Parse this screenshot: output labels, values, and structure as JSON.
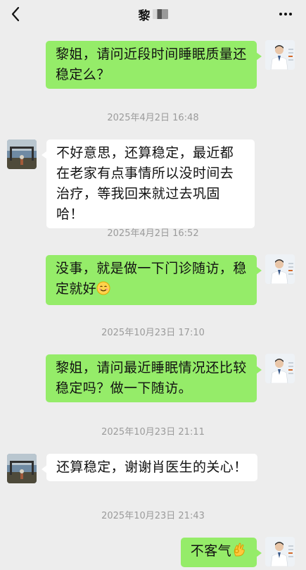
{
  "header": {
    "title": "黎",
    "back_icon": "chevron-left-icon",
    "more_icon": "more-dots-icon"
  },
  "messages": [
    {
      "side": "out",
      "text": "黎姐，请问近段时间睡眠质量还稳定么？"
    },
    {
      "time": "2025年4月2日 16:48"
    },
    {
      "side": "in",
      "text": "不好意思，还算稳定，最近都在老家有点事情所以没时间去治疗，等我回来就过去巩固哈！"
    },
    {
      "time": "2025年4月2日 16:52"
    },
    {
      "side": "out",
      "text": "没事，就是做一下门诊随访，稳定就好",
      "emoji": "smile-emoji"
    },
    {
      "time": "2025年10月23日 17:10"
    },
    {
      "side": "out",
      "text": "黎姐，请问最近睡眠情况还比较稳定吗？做一下随访。"
    },
    {
      "time": "2025年10月23日 21:11"
    },
    {
      "side": "in",
      "text": "还算稳定，谢谢肖医生的关心！"
    },
    {
      "time": "2025年10月23日 21:43"
    },
    {
      "side": "out",
      "text": "不客气",
      "emoji": "ok-hand-emoji"
    }
  ],
  "colors": {
    "background": "#ededed",
    "outgoing_bubble": "#95ec69",
    "incoming_bubble": "#ffffff",
    "timestamp": "#9b9b9b"
  }
}
